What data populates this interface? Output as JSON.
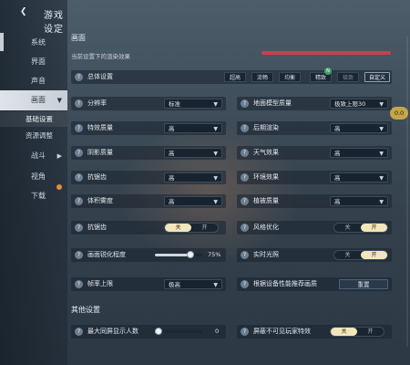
{
  "header": {
    "back_icon": "back-arrow-icon",
    "title": "游戏设定"
  },
  "sidebar": {
    "items": [
      {
        "label": "系统"
      },
      {
        "label": "界面"
      },
      {
        "label": "声音"
      },
      {
        "label": "画面"
      }
    ],
    "subitems": [
      {
        "label": "基础设置"
      },
      {
        "label": "资源调整"
      }
    ],
    "items2": [
      {
        "label": "战斗"
      },
      {
        "label": "视角"
      },
      {
        "label": "下载"
      }
    ]
  },
  "section_visual": {
    "title": "画面",
    "note": "当前设置下的渲染效果"
  },
  "preset_row": {
    "label": "总体设置",
    "options": [
      "超高",
      "流畅",
      "均衡",
      "精致",
      "极致",
      "自定义"
    ],
    "new_badge": "N",
    "active": "自定义"
  },
  "float_badge": "0.0",
  "left_rows": [
    {
      "label": "分辨率",
      "value": "标准"
    },
    {
      "label": "特效质量",
      "value": "高"
    },
    {
      "label": "阴影质量",
      "value": "高"
    },
    {
      "label": "抗锯齿",
      "value": "高"
    },
    {
      "label": "体积雾度",
      "value": "高"
    }
  ],
  "right_rows": [
    {
      "label": "地面模型质量",
      "value": "极致上限30"
    },
    {
      "label": "后期渲染",
      "value": "高"
    },
    {
      "label": "天气效果",
      "value": "高"
    },
    {
      "label": "环境效果",
      "value": "高"
    },
    {
      "label": "植被质量",
      "value": "高"
    }
  ],
  "toggles": {
    "left": {
      "label": "抗锯齿",
      "on_label": "关",
      "off_label": "开",
      "active": "关"
    },
    "right": {
      "label": "风格优化",
      "on_label": "关",
      "off_label": "开",
      "active": "开"
    }
  },
  "sharpness": {
    "label": "画面锐化程度",
    "value": "75%",
    "fraction": 0.75
  },
  "realtime": {
    "label": "实时光照",
    "on_label": "关",
    "off_label": "开",
    "active": "开"
  },
  "fps": {
    "label": "帧率上限",
    "value": "极高"
  },
  "auto_detect": {
    "label": "根据设备性能推荐画质",
    "button": "重置"
  },
  "section_other": {
    "title": "其他设置"
  },
  "max_players": {
    "label": "最大同屏显示人数",
    "value": "0",
    "fraction": 0.02
  },
  "hide_players": {
    "label": "屏蔽不可见玩家特效",
    "on_label": "关",
    "off_label": "开",
    "active": "关"
  }
}
